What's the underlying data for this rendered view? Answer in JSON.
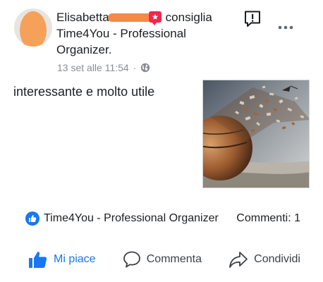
{
  "post": {
    "author_name": "Elisabetta",
    "verb": "consiglia",
    "page_name_line1": "Time4You - Professional",
    "page_name_line2": "Organizer.",
    "timestamp": "13 set alle 11:54",
    "separator": "·",
    "privacy_icon": "globe-icon",
    "text": "interessante e molto utile"
  },
  "reactions": {
    "page_name": "Time4You - Professional Organizer",
    "comments": "Commenti: 1"
  },
  "actions": {
    "like_label": "Mi piace",
    "comment_label": "Commenta",
    "share_label": "Condividi"
  },
  "colors": {
    "accent": "#1877f2",
    "badge": "#f0284a",
    "muted": "#8a8d91"
  }
}
